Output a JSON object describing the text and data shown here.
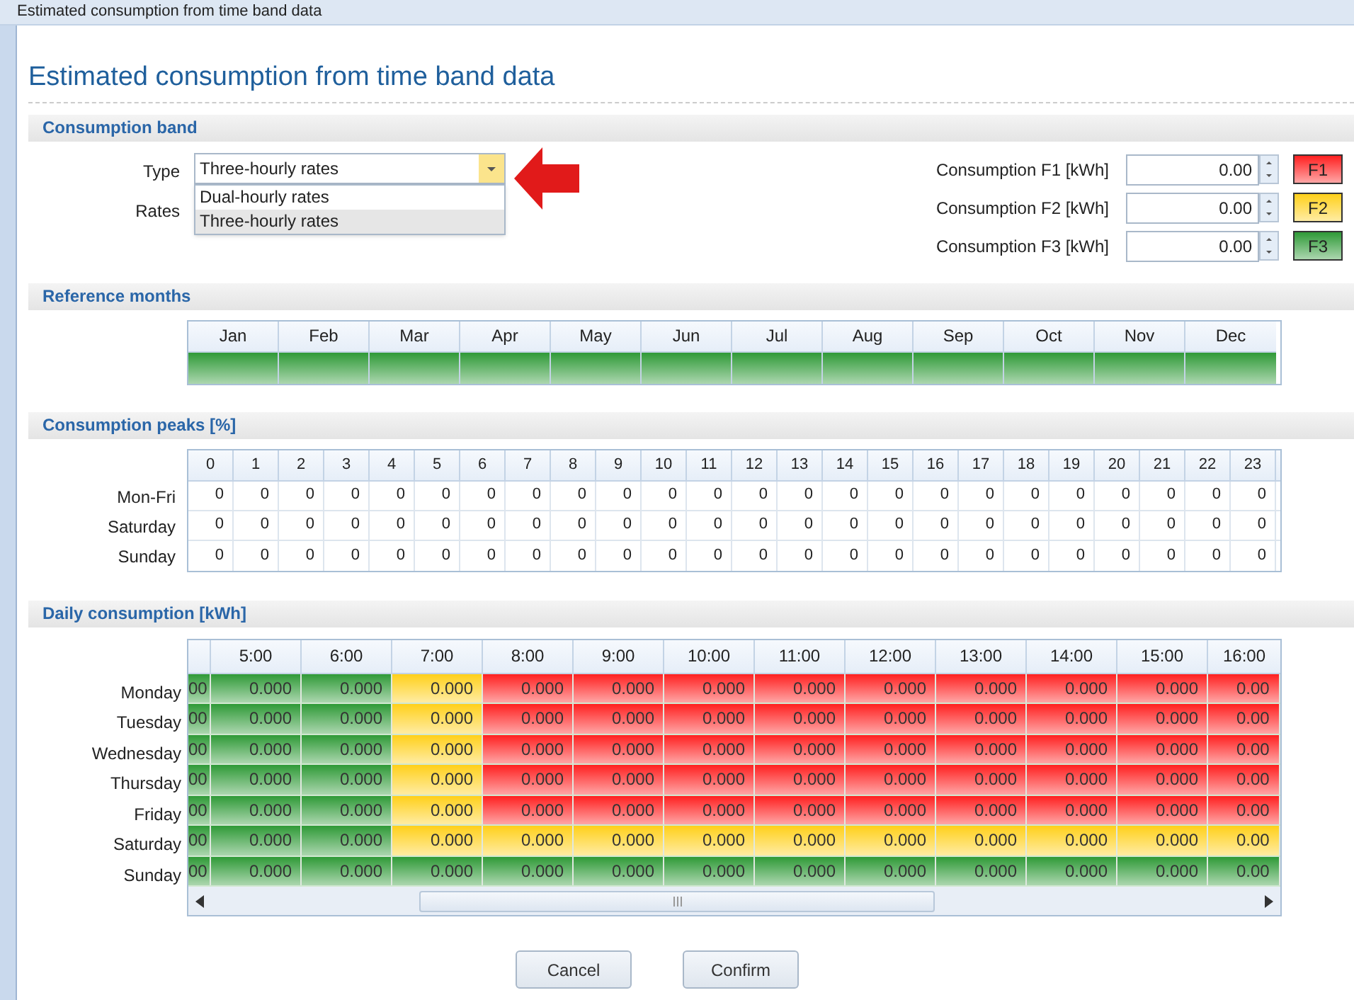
{
  "window": {
    "title": "Estimated consumption from time band data"
  },
  "heading": "Estimated consumption from time band data",
  "consumption_band": {
    "title": "Consumption band",
    "type_label": "Type",
    "type_value": "Three-hourly rates",
    "expanded": true,
    "options": [
      {
        "label": "Dual-hourly rates",
        "selected": false
      },
      {
        "label": "Three-hourly rates",
        "selected": true
      }
    ],
    "rates_label": "Rates",
    "consumptions": [
      {
        "label": "Consumption F1 [kWh]",
        "value": "0.00",
        "color": "#ff2020",
        "badge": "F1"
      },
      {
        "label": "Consumption F2 [kWh]",
        "value": "0.00",
        "color": "#ffd01a",
        "badge": "F2"
      },
      {
        "label": "Consumption F3 [kWh]",
        "value": "0.00",
        "color": "#2f9a37",
        "badge": "F3"
      }
    ]
  },
  "reference_months": {
    "title": "Reference months",
    "months": [
      {
        "label": "Jan",
        "color": "#2f9a37"
      },
      {
        "label": "Feb",
        "color": "#2f9a37"
      },
      {
        "label": "Mar",
        "color": "#2f9a37"
      },
      {
        "label": "Apr",
        "color": "#2f9a37"
      },
      {
        "label": "May",
        "color": "#2f9a37"
      },
      {
        "label": "Jun",
        "color": "#2f9a37"
      },
      {
        "label": "Jul",
        "color": "#2f9a37"
      },
      {
        "label": "Aug",
        "color": "#2f9a37"
      },
      {
        "label": "Sep",
        "color": "#2f9a37"
      },
      {
        "label": "Oct",
        "color": "#2f9a37"
      },
      {
        "label": "Nov",
        "color": "#2f9a37"
      },
      {
        "label": "Dec",
        "color": "#2f9a37"
      }
    ]
  },
  "consumption_peaks": {
    "title": "Consumption peaks [%]",
    "columns": [
      "0",
      "1",
      "2",
      "3",
      "4",
      "5",
      "6",
      "7",
      "8",
      "9",
      "10",
      "11",
      "12",
      "13",
      "14",
      "15",
      "16",
      "17",
      "18",
      "19",
      "20",
      "21",
      "22",
      "23"
    ],
    "rows": [
      {
        "label": "Mon-Fri",
        "values": [
          "0",
          "0",
          "0",
          "0",
          "0",
          "0",
          "0",
          "0",
          "0",
          "0",
          "0",
          "0",
          "0",
          "0",
          "0",
          "0",
          "0",
          "0",
          "0",
          "0",
          "0",
          "0",
          "0",
          "0"
        ]
      },
      {
        "label": "Saturday",
        "values": [
          "0",
          "0",
          "0",
          "0",
          "0",
          "0",
          "0",
          "0",
          "0",
          "0",
          "0",
          "0",
          "0",
          "0",
          "0",
          "0",
          "0",
          "0",
          "0",
          "0",
          "0",
          "0",
          "0",
          "0"
        ]
      },
      {
        "label": "Sunday",
        "values": [
          "0",
          "0",
          "0",
          "0",
          "0",
          "0",
          "0",
          "0",
          "0",
          "0",
          "0",
          "0",
          "0",
          "0",
          "0",
          "0",
          "0",
          "0",
          "0",
          "0",
          "0",
          "0",
          "0",
          "0"
        ]
      }
    ]
  },
  "daily_consumption": {
    "title": "Daily consumption [kWh]",
    "columns": [
      "",
      "5:00",
      "6:00",
      "7:00",
      "8:00",
      "9:00",
      "10:00",
      "11:00",
      "12:00",
      "13:00",
      "14:00",
      "15:00",
      "16:00"
    ],
    "rows": [
      {
        "label": "Monday",
        "cells": [
          {
            "text": "00",
            "color": "#2f9a37"
          },
          {
            "text": "0.000",
            "color": "#2f9a37"
          },
          {
            "text": "0.000",
            "color": "#2f9a37"
          },
          {
            "text": "0.000",
            "color": "#ffd01a"
          },
          {
            "text": "0.000",
            "color": "#ff2020"
          },
          {
            "text": "0.000",
            "color": "#ff2020"
          },
          {
            "text": "0.000",
            "color": "#ff2020"
          },
          {
            "text": "0.000",
            "color": "#ff2020"
          },
          {
            "text": "0.000",
            "color": "#ff2020"
          },
          {
            "text": "0.000",
            "color": "#ff2020"
          },
          {
            "text": "0.000",
            "color": "#ff2020"
          },
          {
            "text": "0.000",
            "color": "#ff2020"
          },
          {
            "text": "0.00",
            "color": "#ff2020"
          }
        ]
      },
      {
        "label": "Tuesday",
        "cells": [
          {
            "text": "00",
            "color": "#2f9a37"
          },
          {
            "text": "0.000",
            "color": "#2f9a37"
          },
          {
            "text": "0.000",
            "color": "#2f9a37"
          },
          {
            "text": "0.000",
            "color": "#ffd01a"
          },
          {
            "text": "0.000",
            "color": "#ff2020"
          },
          {
            "text": "0.000",
            "color": "#ff2020"
          },
          {
            "text": "0.000",
            "color": "#ff2020"
          },
          {
            "text": "0.000",
            "color": "#ff2020"
          },
          {
            "text": "0.000",
            "color": "#ff2020"
          },
          {
            "text": "0.000",
            "color": "#ff2020"
          },
          {
            "text": "0.000",
            "color": "#ff2020"
          },
          {
            "text": "0.000",
            "color": "#ff2020"
          },
          {
            "text": "0.00",
            "color": "#ff2020"
          }
        ]
      },
      {
        "label": "Wednesday",
        "cells": [
          {
            "text": "00",
            "color": "#2f9a37"
          },
          {
            "text": "0.000",
            "color": "#2f9a37"
          },
          {
            "text": "0.000",
            "color": "#2f9a37"
          },
          {
            "text": "0.000",
            "color": "#ffd01a"
          },
          {
            "text": "0.000",
            "color": "#ff2020"
          },
          {
            "text": "0.000",
            "color": "#ff2020"
          },
          {
            "text": "0.000",
            "color": "#ff2020"
          },
          {
            "text": "0.000",
            "color": "#ff2020"
          },
          {
            "text": "0.000",
            "color": "#ff2020"
          },
          {
            "text": "0.000",
            "color": "#ff2020"
          },
          {
            "text": "0.000",
            "color": "#ff2020"
          },
          {
            "text": "0.000",
            "color": "#ff2020"
          },
          {
            "text": "0.00",
            "color": "#ff2020"
          }
        ]
      },
      {
        "label": "Thursday",
        "cells": [
          {
            "text": "00",
            "color": "#2f9a37"
          },
          {
            "text": "0.000",
            "color": "#2f9a37"
          },
          {
            "text": "0.000",
            "color": "#2f9a37"
          },
          {
            "text": "0.000",
            "color": "#ffd01a"
          },
          {
            "text": "0.000",
            "color": "#ff2020"
          },
          {
            "text": "0.000",
            "color": "#ff2020"
          },
          {
            "text": "0.000",
            "color": "#ff2020"
          },
          {
            "text": "0.000",
            "color": "#ff2020"
          },
          {
            "text": "0.000",
            "color": "#ff2020"
          },
          {
            "text": "0.000",
            "color": "#ff2020"
          },
          {
            "text": "0.000",
            "color": "#ff2020"
          },
          {
            "text": "0.000",
            "color": "#ff2020"
          },
          {
            "text": "0.00",
            "color": "#ff2020"
          }
        ]
      },
      {
        "label": "Friday",
        "cells": [
          {
            "text": "00",
            "color": "#2f9a37"
          },
          {
            "text": "0.000",
            "color": "#2f9a37"
          },
          {
            "text": "0.000",
            "color": "#2f9a37"
          },
          {
            "text": "0.000",
            "color": "#ffd01a"
          },
          {
            "text": "0.000",
            "color": "#ff2020"
          },
          {
            "text": "0.000",
            "color": "#ff2020"
          },
          {
            "text": "0.000",
            "color": "#ff2020"
          },
          {
            "text": "0.000",
            "color": "#ff2020"
          },
          {
            "text": "0.000",
            "color": "#ff2020"
          },
          {
            "text": "0.000",
            "color": "#ff2020"
          },
          {
            "text": "0.000",
            "color": "#ff2020"
          },
          {
            "text": "0.000",
            "color": "#ff2020"
          },
          {
            "text": "0.00",
            "color": "#ff2020"
          }
        ]
      },
      {
        "label": "Saturday",
        "cells": [
          {
            "text": "00",
            "color": "#2f9a37"
          },
          {
            "text": "0.000",
            "color": "#2f9a37"
          },
          {
            "text": "0.000",
            "color": "#2f9a37"
          },
          {
            "text": "0.000",
            "color": "#ffd01a"
          },
          {
            "text": "0.000",
            "color": "#ffd01a"
          },
          {
            "text": "0.000",
            "color": "#ffd01a"
          },
          {
            "text": "0.000",
            "color": "#ffd01a"
          },
          {
            "text": "0.000",
            "color": "#ffd01a"
          },
          {
            "text": "0.000",
            "color": "#ffd01a"
          },
          {
            "text": "0.000",
            "color": "#ffd01a"
          },
          {
            "text": "0.000",
            "color": "#ffd01a"
          },
          {
            "text": "0.000",
            "color": "#ffd01a"
          },
          {
            "text": "0.00",
            "color": "#ffd01a"
          }
        ]
      },
      {
        "label": "Sunday",
        "cells": [
          {
            "text": "00",
            "color": "#2f9a37"
          },
          {
            "text": "0.000",
            "color": "#2f9a37"
          },
          {
            "text": "0.000",
            "color": "#2f9a37"
          },
          {
            "text": "0.000",
            "color": "#2f9a37"
          },
          {
            "text": "0.000",
            "color": "#2f9a37"
          },
          {
            "text": "0.000",
            "color": "#2f9a37"
          },
          {
            "text": "0.000",
            "color": "#2f9a37"
          },
          {
            "text": "0.000",
            "color": "#2f9a37"
          },
          {
            "text": "0.000",
            "color": "#2f9a37"
          },
          {
            "text": "0.000",
            "color": "#2f9a37"
          },
          {
            "text": "0.000",
            "color": "#2f9a37"
          },
          {
            "text": "0.000",
            "color": "#2f9a37"
          },
          {
            "text": "0.00",
            "color": "#2f9a37"
          }
        ]
      }
    ]
  },
  "buttons": [
    "Cancel",
    "Confirm"
  ]
}
